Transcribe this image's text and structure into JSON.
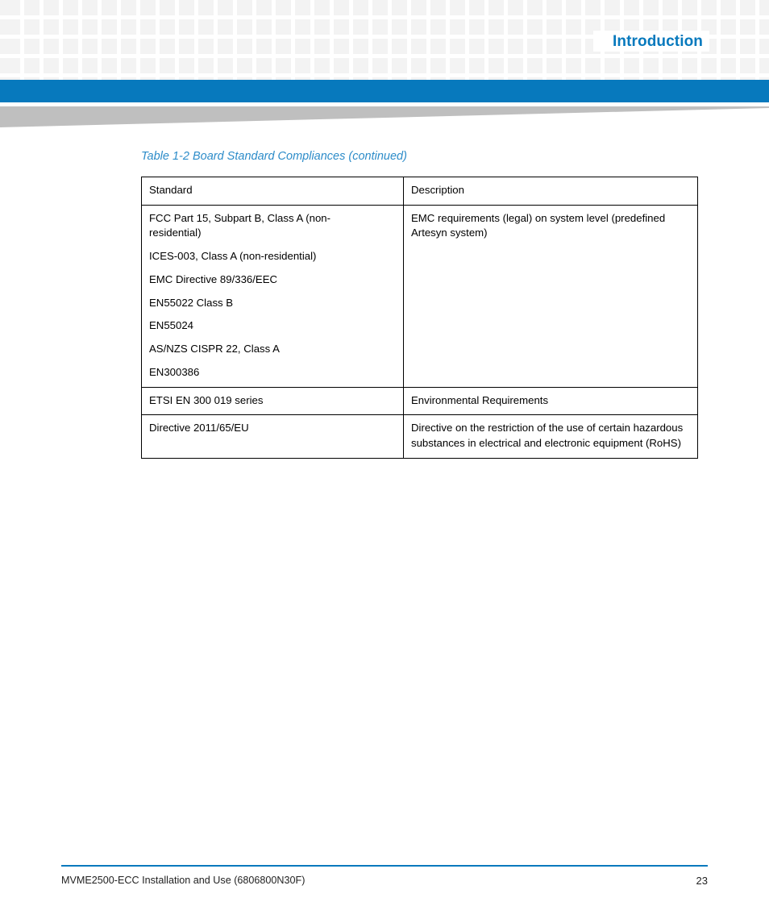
{
  "header": {
    "section_title": "Introduction",
    "accent_color": "#0779bd",
    "grid_cell_color": "#f3f3f3",
    "wedge_color": "#bfbfbf"
  },
  "table": {
    "caption": "Table 1-2 Board Standard Compliances (continued)",
    "caption_color": "#2d8cc9",
    "columns": [
      "Standard",
      "Description"
    ],
    "rows": [
      {
        "standards": [
          "FCC Part 15, Subpart B, Class A (non-residential)",
          "ICES-003, Class A (non-residential)",
          "EMC Directive 89/336/EEC",
          "EN55022 Class B",
          "EN55024",
          "AS/NZS CISPR 22, Class A",
          "EN300386"
        ],
        "description": "EMC requirements (legal) on system level (predefined Artesyn system)"
      },
      {
        "standards": [
          "ETSI EN 300 019 series"
        ],
        "description": "Environmental Requirements"
      },
      {
        "standards": [
          "Directive 2011/65/EU"
        ],
        "description": "Directive on the restriction of the use of certain hazardous substances in electrical and electronic equipment (RoHS)"
      }
    ]
  },
  "footer": {
    "document": "MVME2500-ECC Installation and Use (6806800N30F)",
    "page_number": "23",
    "rule_color": "#0779bd"
  }
}
